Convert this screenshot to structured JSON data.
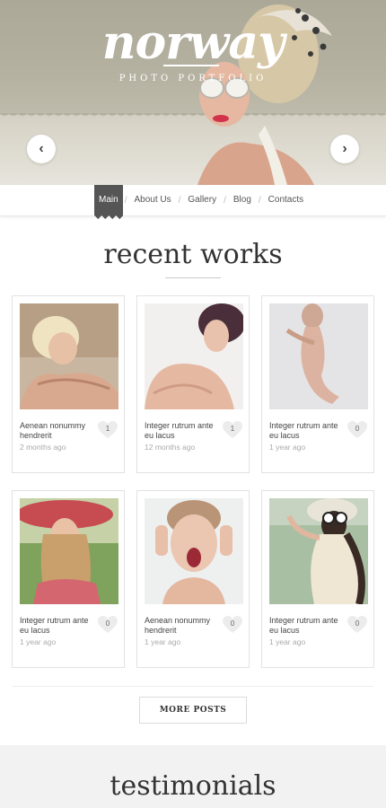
{
  "brand": {
    "logo": "norway",
    "tagline": "PHOTO PORTFOLIO"
  },
  "hero": {
    "prev_label": "‹",
    "next_label": "›"
  },
  "nav": {
    "items": [
      {
        "label": "Main",
        "active": true
      },
      {
        "label": "About Us",
        "active": false
      },
      {
        "label": "Gallery",
        "active": false
      },
      {
        "label": "Blog",
        "active": false
      },
      {
        "label": "Contacts",
        "active": false
      }
    ],
    "separator": "/"
  },
  "recent_works": {
    "title": "recent works",
    "cards": [
      {
        "caption": "Aenean nonummy hendrerit",
        "date": "2 months ago",
        "likes": "1"
      },
      {
        "caption": "Integer rutrum ante eu lacus",
        "date": "12 months ago",
        "likes": "1"
      },
      {
        "caption": "Integer rutrum ante eu lacus",
        "date": "1 year ago",
        "likes": "0"
      },
      {
        "caption": "Integer rutrum ante eu lacus",
        "date": "1 year ago",
        "likes": "0"
      },
      {
        "caption": "Aenean nonummy hendrerit",
        "date": "1 year ago",
        "likes": "0"
      },
      {
        "caption": "Integer rutrum ante eu lacus",
        "date": "1 year ago",
        "likes": "0"
      }
    ],
    "more_label": "MORE POSTS"
  },
  "testimonials": {
    "title": "testimonials"
  },
  "colors": {
    "nav_active": "#555555",
    "heading": "#333333",
    "muted": "#aaaaaa"
  }
}
